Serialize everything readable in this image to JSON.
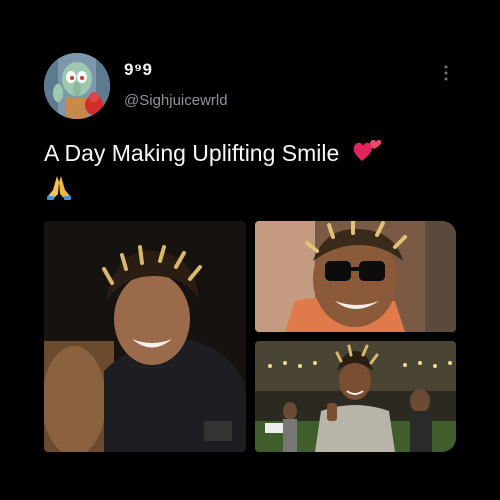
{
  "tweet": {
    "display_name": "9⁹9",
    "handle": "@Sighjuicewrld",
    "text": "A Day Making Uplifting Smile",
    "more_icon": "more-vertical-icon",
    "emojis": [
      "two-hearts-emoji",
      "folded-hands-emoji"
    ]
  },
  "media": [
    {
      "name": "photo-night-smile"
    },
    {
      "name": "photo-sunglasses"
    },
    {
      "name": "photo-party-thumbs-up"
    }
  ],
  "colors": {
    "background": "#000000",
    "text": "#f7f7f7",
    "muted": "#8e949a"
  }
}
